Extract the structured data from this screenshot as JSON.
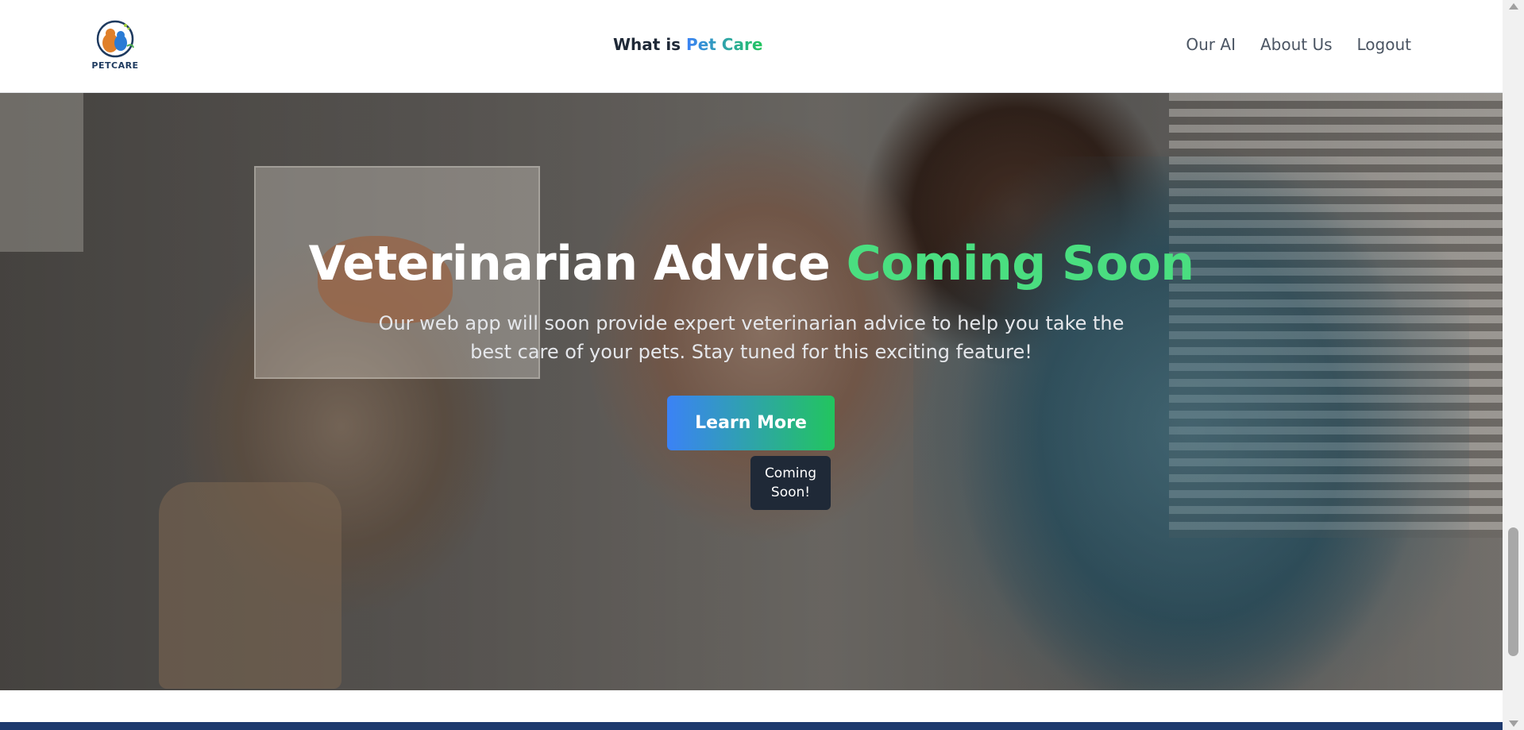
{
  "header": {
    "logo_text": "PETCARE",
    "title_prefix": "What is ",
    "title_accent": "Pet Care",
    "nav": [
      {
        "label": "Our AI"
      },
      {
        "label": "About Us"
      },
      {
        "label": "Logout"
      }
    ]
  },
  "hero": {
    "title": "Veterinarian Advice ",
    "title_accent": "Coming Soon",
    "subtitle": "Our web app will soon provide expert veterinarian advice to help you take the best care of your pets. Stay tuned for this exciting feature!",
    "button_label": "Learn More",
    "tooltip_text": "Coming Soon!"
  },
  "colors": {
    "accent_blue": "#3b82f6",
    "accent_green": "#22c55e",
    "title_green": "#4ade80",
    "tooltip_bg": "#1f2937",
    "footer_band": "#1e3a6e"
  },
  "icons": {
    "logo": "pet-care-logo-icon"
  }
}
